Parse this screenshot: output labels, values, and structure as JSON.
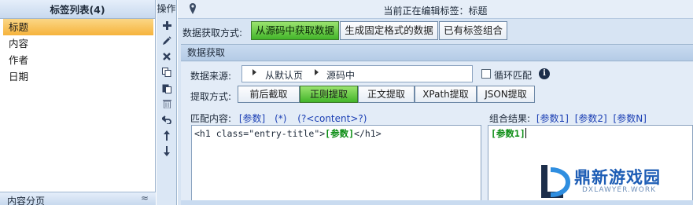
{
  "left_panel": {
    "title": "标签列表(4)",
    "tags": [
      "标题",
      "内容",
      "作者",
      "日期"
    ],
    "selected_index": 0,
    "pagination_label": "内容分页",
    "pagination_arrow": "≈"
  },
  "ops": {
    "title": "操作",
    "buttons": [
      "add-icon",
      "edit-icon",
      "delete-icon",
      "copy-icon",
      "paste-icon",
      "trash-icon",
      "undo-icon",
      "move-up-icon",
      "move-down-icon"
    ]
  },
  "header": {
    "editing_text": "当前正在编辑标签：标题"
  },
  "method": {
    "label": "数据获取方式:",
    "options": [
      "从源码中获取数据",
      "生成固定格式的数据",
      "已有标签组合"
    ],
    "active_index": 0
  },
  "fetch": {
    "section_title": "数据获取",
    "source_label": "数据来源:",
    "source_crumbs": [
      "从默认页",
      "源码中"
    ],
    "loop_label": "循环匹配",
    "loop_checked": false,
    "info_icon": "i",
    "extract_label": "提取方式:",
    "extract_options": [
      "前后截取",
      "正则提取",
      "正文提取",
      "XPath提取",
      "JSON提取"
    ],
    "extract_active_index": 1,
    "match_label": "匹配内容:",
    "match_tokens": [
      "[参数]",
      "(*)",
      "(?<content>?)"
    ],
    "result_label": "组合结果:",
    "result_tokens": [
      "[参数1]",
      "[参数2]",
      "[参数N]"
    ],
    "pattern_prefix": "<h1 class=\"entry-title\">",
    "pattern_param": "[参数]",
    "pattern_suffix": "</h1>",
    "result_value": "[参数1]"
  },
  "watermark": {
    "title": "鼎新游戏园",
    "subtitle": "DXLAWYER.WORK"
  },
  "colors": {
    "active_green": "#43b52a",
    "selected_orange": "#f6b33c",
    "token_blue": "#1b3fb4",
    "param_green": "#0a8c12"
  }
}
